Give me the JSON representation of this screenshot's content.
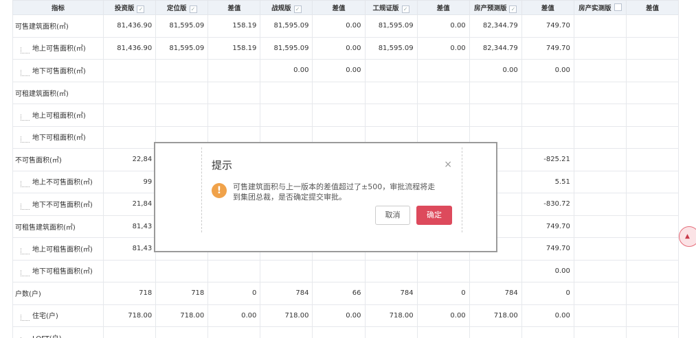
{
  "table": {
    "headers": [
      {
        "label": "指标",
        "checkbox": false
      },
      {
        "label": "投资版",
        "checkbox": true,
        "checked": true
      },
      {
        "label": "定位版",
        "checkbox": true,
        "checked": true
      },
      {
        "label": "差值",
        "checkbox": false
      },
      {
        "label": "战规版",
        "checkbox": true,
        "checked": true
      },
      {
        "label": "差值",
        "checkbox": false
      },
      {
        "label": "工规证版",
        "checkbox": true,
        "checked": true
      },
      {
        "label": "差值",
        "checkbox": false
      },
      {
        "label": "房产预测版",
        "checkbox": true,
        "checked": true
      },
      {
        "label": "差值",
        "checkbox": false
      },
      {
        "label": "房产实测版",
        "checkbox": true,
        "checked": false
      },
      {
        "label": "差值",
        "checkbox": false
      }
    ],
    "rows": [
      {
        "label": "可售建筑面积(㎡)",
        "child": false,
        "cells": [
          "81,436.90",
          "81,595.09",
          "158.19",
          "81,595.09",
          "0.00",
          "81,595.09",
          "0.00",
          "82,344.79",
          "749.70",
          "",
          ""
        ]
      },
      {
        "label": "地上可售面积(㎡)",
        "child": true,
        "cells": [
          "81,436.90",
          "81,595.09",
          "158.19",
          "81,595.09",
          "0.00",
          "81,595.09",
          "0.00",
          "82,344.79",
          "749.70",
          "",
          ""
        ]
      },
      {
        "label": "地下可售面积(㎡)",
        "child": true,
        "cells": [
          "",
          "",
          "",
          "0.00",
          "0.00",
          "",
          "",
          "0.00",
          "0.00",
          "",
          ""
        ]
      },
      {
        "label": "可租建筑面积(㎡)",
        "child": false,
        "cells": [
          "",
          "",
          "",
          "",
          "",
          "",
          "",
          "",
          "",
          "",
          ""
        ]
      },
      {
        "label": "地上可租面积(㎡)",
        "child": true,
        "cells": [
          "",
          "",
          "",
          "",
          "",
          "",
          "",
          "",
          "",
          "",
          ""
        ]
      },
      {
        "label": "地下可租面积(㎡)",
        "child": true,
        "cells": [
          "",
          "",
          "",
          "",
          "",
          "",
          "",
          "",
          "",
          "",
          ""
        ]
      },
      {
        "label": "不可售面积(㎡)",
        "child": false,
        "cells": [
          "22,84",
          "",
          "",
          "",
          "",
          "",
          "",
          "",
          "-825.21",
          "",
          ""
        ]
      },
      {
        "label": "地上不可售面积(㎡)",
        "child": true,
        "cells": [
          "99",
          "",
          "",
          "",
          "",
          "",
          "",
          "",
          "5.51",
          "",
          ""
        ]
      },
      {
        "label": "地下不可售面积(㎡)",
        "child": true,
        "cells": [
          "21,84",
          "",
          "",
          "",
          "",
          "",
          "",
          "",
          "-830.72",
          "",
          ""
        ]
      },
      {
        "label": "可租售建筑面积(㎡)",
        "child": false,
        "cells": [
          "81,43",
          "",
          "",
          "",
          "",
          "",
          "",
          "",
          "749.70",
          "",
          ""
        ]
      },
      {
        "label": "地上可租售面积(㎡)",
        "child": true,
        "cells": [
          "81,43",
          "",
          "",
          "",
          "",
          "",
          "",
          "",
          "749.70",
          "",
          ""
        ]
      },
      {
        "label": "地下可租售面积(㎡)",
        "child": true,
        "cells": [
          "",
          "",
          "",
          "",
          "",
          "",
          "",
          "",
          "0.00",
          "",
          ""
        ]
      },
      {
        "label": "户数(户)",
        "child": false,
        "cells": [
          "718",
          "718",
          "0",
          "784",
          "66",
          "784",
          "0",
          "784",
          "0",
          "",
          ""
        ]
      },
      {
        "label": "住宅(户)",
        "child": true,
        "cells": [
          "718.00",
          "718.00",
          "0.00",
          "718.00",
          "0.00",
          "718.00",
          "0.00",
          "718.00",
          "0.00",
          "",
          ""
        ]
      },
      {
        "label": "LOFT(户)",
        "child": true,
        "cells": [
          "",
          "",
          "",
          "",
          "",
          "",
          "",
          "",
          "",
          "",
          ""
        ]
      }
    ]
  },
  "dialog": {
    "title": "提示",
    "close_glyph": "×",
    "warn_glyph": "!",
    "message": "可售建筑面积与上一版本的差值超过了±500，审批流程将走到集团总裁，是否确定提交审批。",
    "cancel_label": "取消",
    "confirm_label": "确定",
    "confirm_color": "#dd4a5c"
  },
  "scroll_top": {
    "glyph": "▲",
    "icon": "chevron-up-icon"
  }
}
